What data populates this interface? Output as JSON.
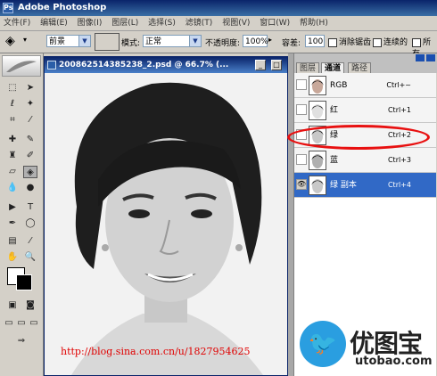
{
  "app": {
    "title": "Adobe Photoshop"
  },
  "menu": [
    "文件(F)",
    "编辑(E)",
    "图像(I)",
    "图层(L)",
    "选择(S)",
    "滤镜(T)",
    "视图(V)",
    "窗口(W)",
    "帮助(H)"
  ],
  "options": {
    "fill_select": "前景",
    "mode_label": "模式:",
    "mode_value": "正常",
    "opacity_label": "不透明度:",
    "opacity_value": "100%",
    "tolerance_label": "容差:",
    "tolerance_value": "100",
    "antialias_label": "消除锯齿",
    "contiguous_label": "连续的",
    "all_layers_label": "所有"
  },
  "document": {
    "title": "200862514385238_2.psd @ 66.7% (..."
  },
  "panel": {
    "tabs": [
      "图层",
      "通道",
      "路径"
    ],
    "active_tab": "通道",
    "channels": [
      {
        "name": "RGB",
        "shortcut": "Ctrl+~",
        "visible": false,
        "selected": false
      },
      {
        "name": "红",
        "shortcut": "Ctrl+1",
        "visible": false,
        "selected": false
      },
      {
        "name": "绿",
        "shortcut": "Ctrl+2",
        "visible": false,
        "selected": false
      },
      {
        "name": "蓝",
        "shortcut": "Ctrl+3",
        "visible": false,
        "selected": false
      },
      {
        "name": "绿 副本",
        "shortcut": "Ctrl+4",
        "visible": true,
        "selected": true
      }
    ]
  },
  "watermark": {
    "url": "http://blog.sina.com.cn/u/1827954625",
    "logo_cn": "优图宝",
    "logo_en": "utobao.com"
  },
  "colors": {
    "title_bar": "#0a246a",
    "selection": "#3169c6",
    "annotation": "#e81010",
    "watermark": "#e00000"
  }
}
